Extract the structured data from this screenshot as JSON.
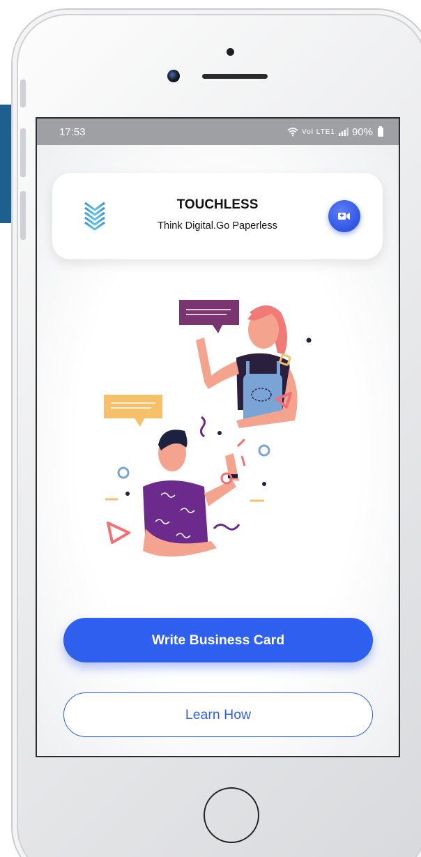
{
  "status_bar": {
    "time": "17:53",
    "network_label": "Vol LTE1",
    "battery": "90%"
  },
  "header": {
    "title": "TOUCHLESS",
    "tagline": "Think Digital.Go Paperless",
    "logo_icon": "chevron-stack-icon",
    "video_icon": "video-camera-icon"
  },
  "illustration": {
    "description_icon": "two-people-chatting-illustration"
  },
  "actions": {
    "primary_label": "Write Business Card",
    "secondary_label": "Learn How"
  },
  "colors": {
    "accent": "#2f5fef",
    "status_bar": "#9ea0a4",
    "background": "#f2f3f5"
  }
}
